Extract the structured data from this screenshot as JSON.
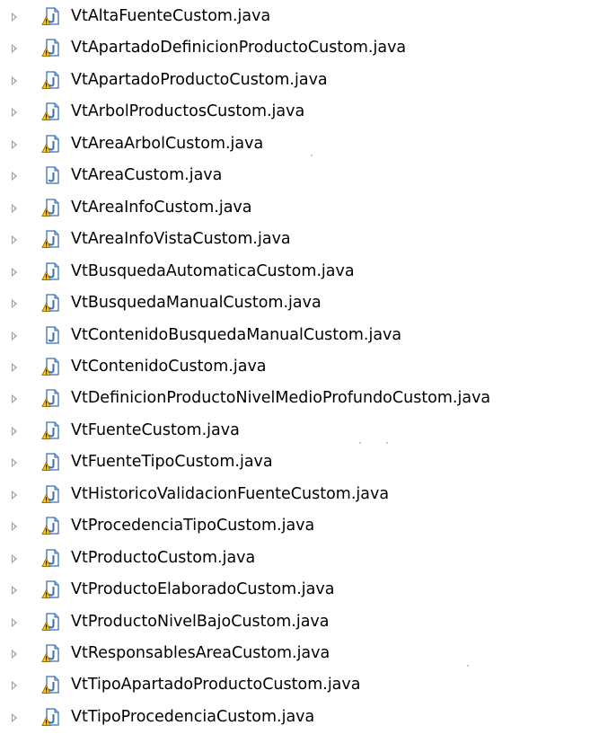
{
  "explorer": {
    "items": [
      {
        "label": "VtAltaFuenteCustom.java",
        "icon": "java-file-dirty-icon",
        "modified": true
      },
      {
        "label": "VtApartadoDefinicionProductoCustom.java",
        "icon": "java-file-dirty-icon",
        "modified": true
      },
      {
        "label": "VtApartadoProductoCustom.java",
        "icon": "java-file-dirty-icon",
        "modified": true
      },
      {
        "label": "VtArbolProductosCustom.java",
        "icon": "java-file-dirty-icon",
        "modified": true
      },
      {
        "label": "VtAreaArbolCustom.java",
        "icon": "java-file-dirty-icon",
        "modified": true
      },
      {
        "label": "VtAreaCustom.java",
        "icon": "java-file-icon",
        "modified": false
      },
      {
        "label": "VtAreaInfoCustom.java",
        "icon": "java-file-dirty-icon",
        "modified": true
      },
      {
        "label": "VtAreaInfoVistaCustom.java",
        "icon": "java-file-dirty-icon",
        "modified": true
      },
      {
        "label": "VtBusquedaAutomaticaCustom.java",
        "icon": "java-file-dirty-icon",
        "modified": true
      },
      {
        "label": "VtBusquedaManualCustom.java",
        "icon": "java-file-dirty-icon",
        "modified": true
      },
      {
        "label": "VtContenidoBusquedaManualCustom.java",
        "icon": "java-file-icon",
        "modified": false
      },
      {
        "label": "VtContenidoCustom.java",
        "icon": "java-file-dirty-icon",
        "modified": true
      },
      {
        "label": "VtDefinicionProductoNivelMedioProfundoCustom.java",
        "icon": "java-file-dirty-icon",
        "modified": true
      },
      {
        "label": "VtFuenteCustom.java",
        "icon": "java-file-dirty-icon",
        "modified": true
      },
      {
        "label": "VtFuenteTipoCustom.java",
        "icon": "java-file-dirty-icon",
        "modified": true
      },
      {
        "label": "VtHistoricoValidacionFuenteCustom.java",
        "icon": "java-file-dirty-icon",
        "modified": true
      },
      {
        "label": "VtProcedenciaTipoCustom.java",
        "icon": "java-file-dirty-icon",
        "modified": true
      },
      {
        "label": "VtProductoCustom.java",
        "icon": "java-file-dirty-icon",
        "modified": true
      },
      {
        "label": "VtProductoElaboradoCustom.java",
        "icon": "java-file-dirty-icon",
        "modified": true
      },
      {
        "label": "VtProductoNivelBajoCustom.java",
        "icon": "java-file-dirty-icon",
        "modified": true
      },
      {
        "label": "VtResponsablesAreaCustom.java",
        "icon": "java-file-dirty-icon",
        "modified": true
      },
      {
        "label": "VtTipoApartadoProductoCustom.java",
        "icon": "java-file-dirty-icon",
        "modified": true
      },
      {
        "label": "VtTipoProcedenciaCustom.java",
        "icon": "java-file-dirty-icon",
        "modified": true
      }
    ]
  },
  "colors": {
    "file_blue": "#3b6fb6",
    "file_blue_light": "#8fb4e3",
    "warning_yellow": "#f2c230",
    "warning_outline": "#9c7400",
    "expander_gray": "#9a9a9a"
  }
}
